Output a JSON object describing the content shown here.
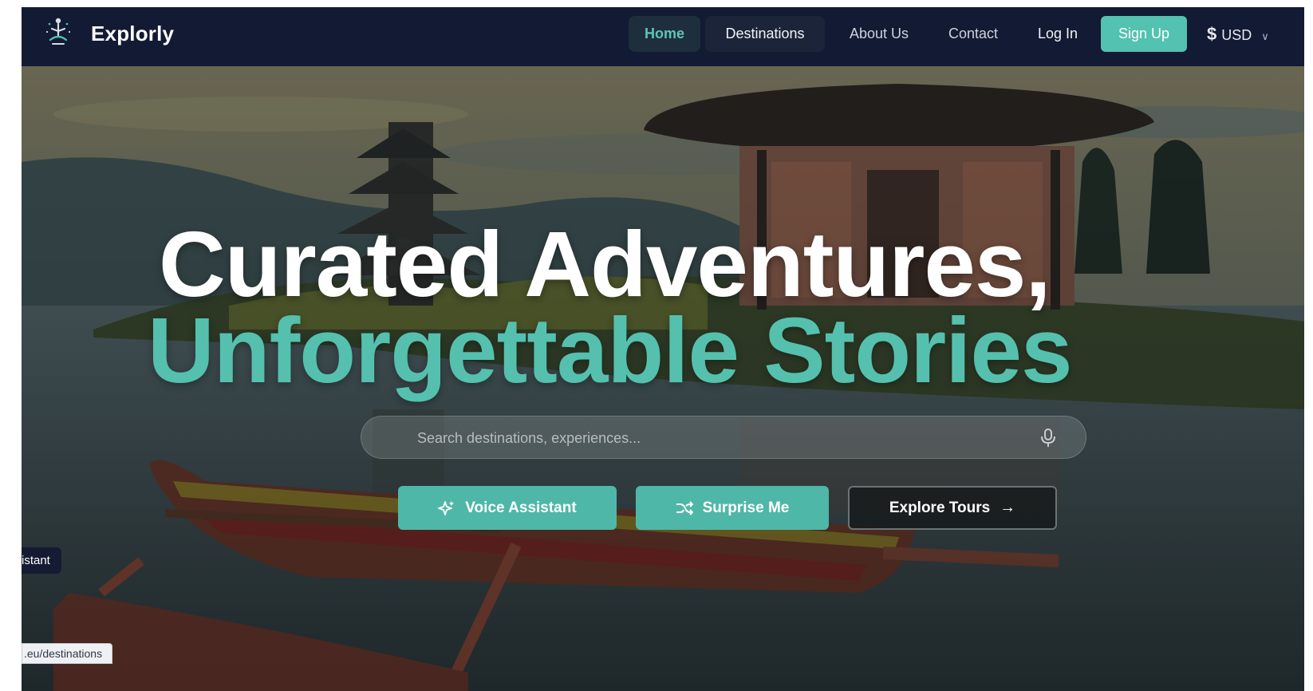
{
  "brand": {
    "name": "Explorly",
    "logo_icon": "meditation-figure-icon"
  },
  "nav": {
    "items": [
      {
        "label": "Home",
        "active": true
      },
      {
        "label": "Destinations",
        "hovered": true
      },
      {
        "label": "About Us"
      },
      {
        "label": "Contact"
      },
      {
        "label": "Log In"
      }
    ],
    "signup_label": "Sign Up",
    "currency": {
      "symbol": "$",
      "code": "USD",
      "icon": "chevron-down-icon"
    }
  },
  "hero": {
    "headline_line1": "Curated Adventures,",
    "headline_line2": "Unforgettable Stories",
    "search": {
      "placeholder": "Search destinations, experiences...",
      "value": "",
      "icon": "microphone-icon"
    },
    "buttons": {
      "voice": {
        "label": "Voice Assistant",
        "icon": "sparkle-icon"
      },
      "surprise": {
        "label": "Surprise Me",
        "icon": "shuffle-icon"
      },
      "tours": {
        "label": "Explore Tours",
        "icon": "arrow-right-icon"
      }
    }
  },
  "floating": {
    "tooltip_text": "istant",
    "status_url": ".eu/destinations"
  },
  "colors": {
    "nav_bg": "#131a33",
    "accent": "#55c0ae",
    "button_teal": "#4fb7a7"
  }
}
